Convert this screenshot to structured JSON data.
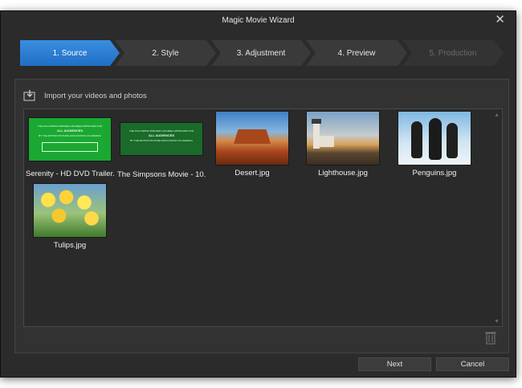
{
  "window": {
    "title": "Magic Movie Wizard"
  },
  "steps": [
    {
      "label": "1. Source"
    },
    {
      "label": "2. Style"
    },
    {
      "label": "3. Adjustment"
    },
    {
      "label": "4. Preview"
    },
    {
      "label": "5. Production"
    }
  ],
  "import": {
    "label": "Import your videos and photos"
  },
  "media": [
    {
      "caption": "Serenity - HD DVD Trailer...."
    },
    {
      "caption": "The Simpsons Movie - 10..."
    },
    {
      "caption": "Desert.jpg"
    },
    {
      "caption": "Lighthouse.jpg"
    },
    {
      "caption": "Penguins.jpg"
    },
    {
      "caption": "Tulips.jpg"
    }
  ],
  "thumb_text": {
    "serenity_line1": "THE FOLLOWING PREVIEW HAS BEEN APPROVED FOR",
    "serenity_line2": "ALL AUDIENCES",
    "serenity_line3": "BY THE MOTION PICTURE ASSOCIATION OF AMERICA",
    "simpsons_line1": "THE FOLLOWING PREVIEW HAS BEEN APPROVED FOR",
    "simpsons_line2": "ALL AUDIENCES",
    "simpsons_line3": "BY THE MOTION PICTURE ASSOCIATION OF AMERICA"
  },
  "buttons": {
    "next": "Next",
    "cancel": "Cancel"
  },
  "icons": {
    "close": "close-icon",
    "import": "import-icon",
    "trash": "trash-icon",
    "scroll_up": "scroll-up-icon",
    "scroll_down": "scroll-down-icon"
  },
  "colors": {
    "accent": "#2c7fd6",
    "window_bg": "#2b2b2b",
    "panel_bg": "#323232",
    "trailer_green": "#1aa832"
  }
}
